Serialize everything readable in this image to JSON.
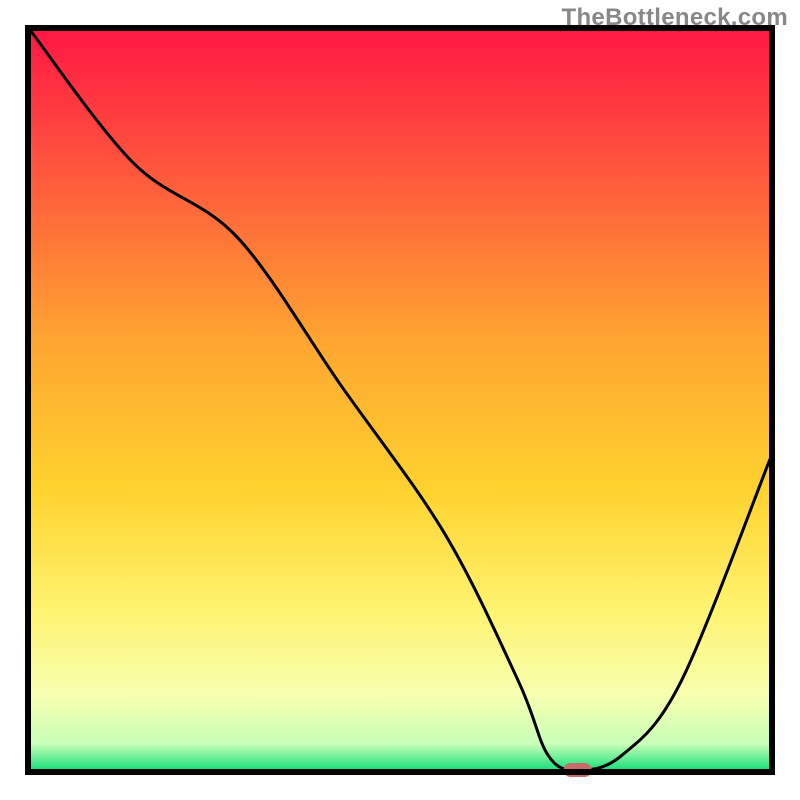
{
  "watermark": "TheBottleneck.com",
  "chart_data": {
    "type": "line",
    "title": "",
    "xlabel": "",
    "ylabel": "",
    "xlim": [
      0,
      100
    ],
    "ylim": [
      0,
      100
    ],
    "x": [
      0,
      14,
      28,
      42,
      56,
      66,
      70,
      74,
      80,
      88,
      100
    ],
    "values": [
      100,
      82,
      72,
      52,
      32,
      12,
      2,
      0,
      2,
      12,
      42
    ],
    "series": [
      {
        "name": "curve",
        "x": [
          0,
          14,
          28,
          42,
          56,
          66,
          70,
          74,
          80,
          88,
          100
        ],
        "values": [
          100,
          82,
          72,
          52,
          32,
          12,
          2,
          0,
          2,
          12,
          42
        ]
      }
    ],
    "marker": {
      "x": 74,
      "y": 0,
      "color": "#c76b6b"
    },
    "background_gradient": {
      "type": "vertical",
      "stops": [
        {
          "offset": 0.0,
          "color": "#ff1744"
        },
        {
          "offset": 0.2,
          "color": "#ff5a3c"
        },
        {
          "offset": 0.42,
          "color": "#ffa531"
        },
        {
          "offset": 0.62,
          "color": "#ffd22e"
        },
        {
          "offset": 0.78,
          "color": "#fff36e"
        },
        {
          "offset": 0.9,
          "color": "#f7ffb0"
        },
        {
          "offset": 0.965,
          "color": "#c8ffb8"
        },
        {
          "offset": 1.0,
          "color": "#18e07a"
        }
      ]
    }
  }
}
